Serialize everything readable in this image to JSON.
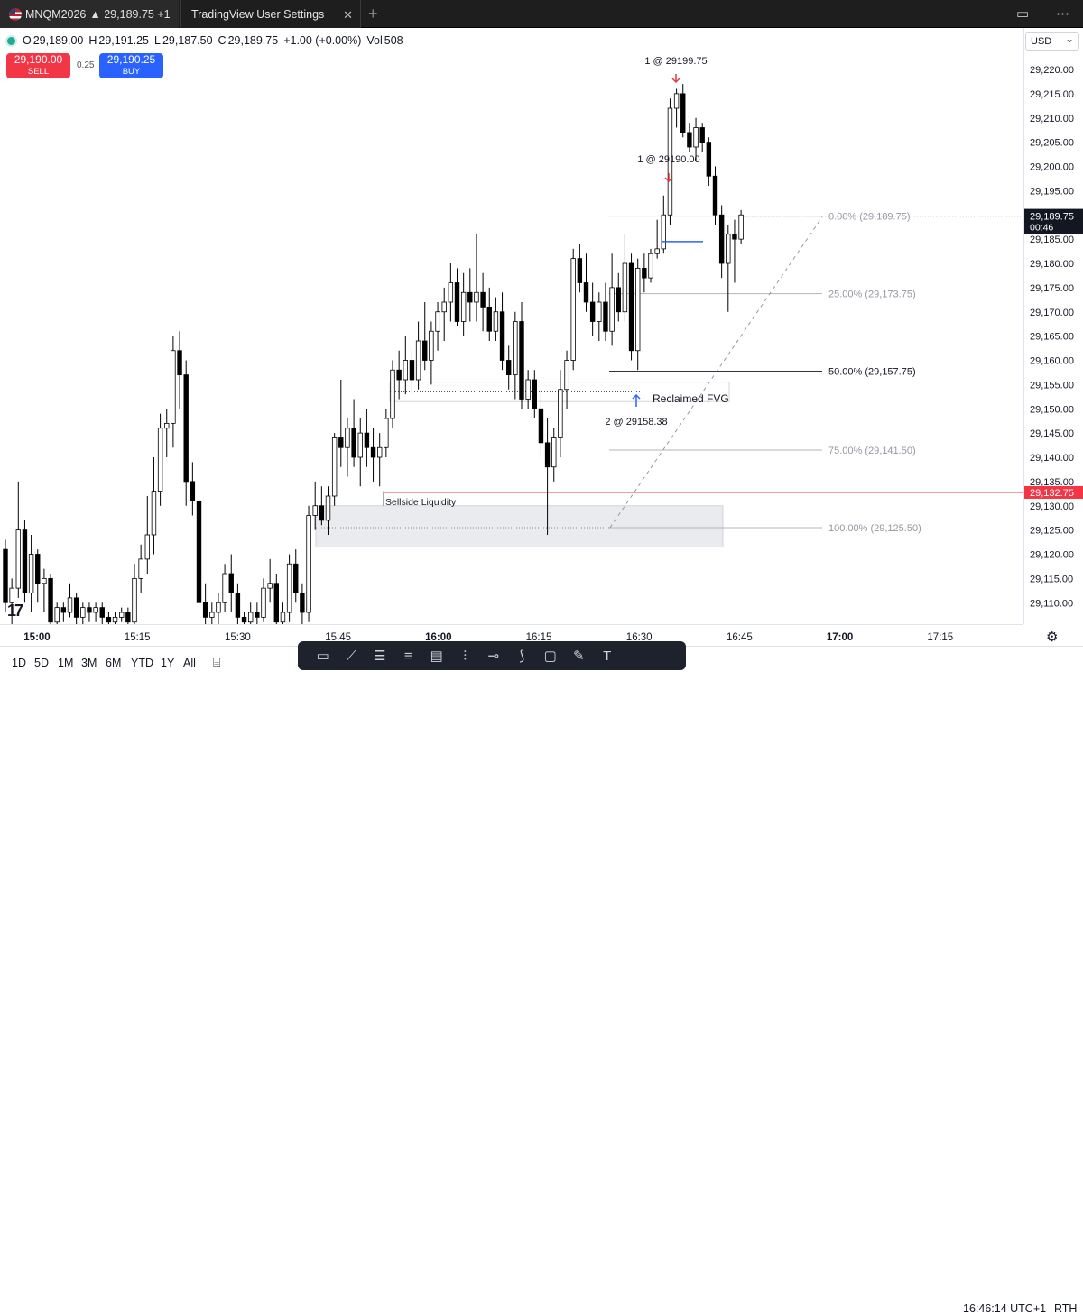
{
  "tabs": [
    {
      "symbol": "MNQM2026",
      "price": "▲ 29,189.75 +1"
    },
    {
      "label": "TradingView User Settings"
    }
  ],
  "legend": {
    "o_key": "O",
    "o_val": "29,189.00",
    "h_key": "H",
    "h_val": "29,191.25",
    "l_key": "L",
    "l_val": "29,187.50",
    "c_key": "C",
    "c_val": "29,189.75",
    "change": "+1.00 (+0.00%)",
    "vol_key": "Vol",
    "vol_val": "508"
  },
  "trade": {
    "sell_price": "29,190.00",
    "sell_label": "SELL",
    "spread": "0.25",
    "buy_price": "29,190.25",
    "buy_label": "BUY"
  },
  "price_axis": {
    "currency": "USD",
    "ticks": [
      "29,220.00",
      "29,215.00",
      "29,210.00",
      "29,205.00",
      "29,200.00",
      "29,195.00",
      "29,190.00",
      "29,185.00",
      "29,180.00",
      "29,175.00",
      "29,170.00",
      "29,165.00",
      "29,160.00",
      "29,155.00",
      "29,150.00",
      "29,145.00",
      "29,140.00",
      "29,135.00",
      "29,130.00",
      "29,125.00",
      "29,120.00",
      "29,115.00",
      "29,110.00"
    ],
    "current_price": "29,189.75",
    "countdown": "00:46",
    "red_line_price": "29,132.75"
  },
  "time_axis": {
    "ticks": [
      {
        "label": "15:00",
        "bold": true
      },
      {
        "label": "15:15",
        "bold": false
      },
      {
        "label": "15:30",
        "bold": false
      },
      {
        "label": "15:45",
        "bold": false
      },
      {
        "label": "16:00",
        "bold": true
      },
      {
        "label": "16:15",
        "bold": false
      },
      {
        "label": "16:30",
        "bold": false
      },
      {
        "label": "16:45",
        "bold": false
      },
      {
        "label": "17:00",
        "bold": true
      },
      {
        "label": "17:15",
        "bold": false
      }
    ]
  },
  "fib_levels": [
    {
      "label": "0.00% (29,189.75)",
      "price": 29189.75,
      "emphasis": false
    },
    {
      "label": "25.00% (29,173.75)",
      "price": 29173.75,
      "emphasis": false
    },
    {
      "label": "50.00% (29,157.75)",
      "price": 29157.75,
      "emphasis": true
    },
    {
      "label": "75.00% (29,141.50)",
      "price": 29141.5,
      "emphasis": false
    },
    {
      "label": "100.00% (29,125.50)",
      "price": 29125.5,
      "emphasis": false
    }
  ],
  "annotations": {
    "sellside_liquidity": "Sellside Liquidity",
    "reclaimed_fvg": "Reclaimed FVG",
    "exec_top": "1 @ 29199.75",
    "exec_mid": "1 @ 29190.00",
    "exec_buy": "2 @ 29158.38"
  },
  "ranges": [
    "1D",
    "5D",
    "1M",
    "3M",
    "6M",
    "YTD",
    "1Y",
    "All"
  ],
  "drawing_tools": [
    "rectangle-icon",
    "trendline-icon",
    "fib-icon",
    "pitchfork-icon",
    "gann-icon",
    "long-position-icon",
    "ray-icon",
    "path-icon",
    "callout-icon",
    "brush-icon",
    "text-icon"
  ],
  "status": {
    "clock": "16:46:14 UTC+1",
    "session": "RTH"
  },
  "colors": {
    "up": "#ffffff",
    "down": "#000000",
    "sell": "#f23645",
    "buy": "#2962ff",
    "exec_sell": "#e53935",
    "exec_buy": "#2962ff"
  },
  "chart_data": {
    "type": "candlestick",
    "title": "",
    "ylim": [
      29105,
      29225
    ],
    "candles": [
      [
        29121,
        29123,
        29108,
        29110
      ],
      [
        29110,
        29115,
        29105,
        29113
      ],
      [
        29113,
        29135,
        29111,
        29125
      ],
      [
        29125,
        29127,
        29110,
        29112
      ],
      [
        29112,
        29124,
        29108,
        29120
      ],
      [
        29120,
        29121,
        29110,
        29114
      ],
      [
        29114,
        29117,
        29108,
        29115
      ],
      [
        29115,
        29116,
        29105,
        29106
      ],
      [
        29106,
        29110,
        29105,
        29109
      ],
      [
        29109,
        29110,
        29106,
        29108
      ],
      [
        29108,
        29114,
        29107,
        29111
      ],
      [
        29111,
        29112,
        29105,
        29107
      ],
      [
        29107,
        29110,
        29105,
        29109
      ],
      [
        29109,
        29110,
        29106,
        29108
      ],
      [
        29108,
        29110,
        29106,
        29109
      ],
      [
        29109,
        29110,
        29105,
        29107
      ],
      [
        29107,
        29108,
        29105,
        29106
      ],
      [
        29106,
        29108,
        29105,
        29107
      ],
      [
        29107,
        29109,
        29106,
        29108
      ],
      [
        29108,
        29109,
        29105,
        29106
      ],
      [
        29106,
        29118,
        29105,
        29115
      ],
      [
        29115,
        29122,
        29112,
        29119
      ],
      [
        29119,
        29132,
        29116,
        29124
      ],
      [
        29124,
        29140,
        29120,
        29133
      ],
      [
        29133,
        29149,
        29130,
        29146
      ],
      [
        29146,
        29150,
        29140,
        29147
      ],
      [
        29147,
        29165,
        29142,
        29162
      ],
      [
        29162,
        29166,
        29150,
        29157
      ],
      [
        29157,
        29160,
        29130,
        29135
      ],
      [
        29135,
        29139,
        29128,
        29131
      ],
      [
        29131,
        29135,
        29105,
        29110
      ],
      [
        29110,
        29114,
        29105,
        29107
      ],
      [
        29107,
        29110,
        29105,
        29108
      ],
      [
        29108,
        29112,
        29105,
        29110
      ],
      [
        29110,
        29118,
        29108,
        29116
      ],
      [
        29116,
        29120,
        29108,
        29112
      ],
      [
        29112,
        29114,
        29105,
        29107
      ],
      [
        29107,
        29108,
        29105,
        29106
      ],
      [
        29106,
        29110,
        29105,
        29108
      ],
      [
        29108,
        29110,
        29105,
        29107
      ],
      [
        29107,
        29115,
        29106,
        29113
      ],
      [
        29113,
        29119,
        29110,
        29114
      ],
      [
        29114,
        29116,
        29105,
        29106
      ],
      [
        29106,
        29110,
        29105,
        29108
      ],
      [
        29108,
        29120,
        29106,
        29118
      ],
      [
        29118,
        29121,
        29110,
        29112
      ],
      [
        29112,
        29114,
        29105,
        29108
      ],
      [
        29108,
        29130,
        29106,
        29128
      ],
      [
        29128,
        29135,
        29125,
        29130
      ],
      [
        29130,
        29134,
        29126,
        29127
      ],
      [
        29127,
        29134,
        29124,
        29132
      ],
      [
        29132,
        29145,
        29130,
        29144
      ],
      [
        29144,
        29156,
        29138,
        29142
      ],
      [
        29142,
        29148,
        29136,
        29146
      ],
      [
        29146,
        29152,
        29138,
        29140
      ],
      [
        29140,
        29148,
        29134,
        29145
      ],
      [
        29145,
        29150,
        29138,
        29142
      ],
      [
        29142,
        29146,
        29135,
        29140
      ],
      [
        29140,
        29145,
        29134,
        29142
      ],
      [
        29142,
        29150,
        29140,
        29148
      ],
      [
        29148,
        29160,
        29146,
        29158
      ],
      [
        29158,
        29162,
        29152,
        29156
      ],
      [
        29156,
        29165,
        29153,
        29160
      ],
      [
        29160,
        29162,
        29153,
        29156
      ],
      [
        29156,
        29168,
        29154,
        29164
      ],
      [
        29164,
        29172,
        29158,
        29160
      ],
      [
        29160,
        29168,
        29155,
        29166
      ],
      [
        29166,
        29172,
        29162,
        29170
      ],
      [
        29170,
        29175,
        29164,
        29172
      ],
      [
        29172,
        29180,
        29168,
        29176
      ],
      [
        29176,
        29179,
        29167,
        29168
      ],
      [
        29168,
        29178,
        29165,
        29174
      ],
      [
        29174,
        29179,
        29168,
        29172
      ],
      [
        29172,
        29186,
        29168,
        29174
      ],
      [
        29174,
        29178,
        29166,
        29171
      ],
      [
        29171,
        29175,
        29164,
        29166
      ],
      [
        29166,
        29173,
        29164,
        29170
      ],
      [
        29170,
        29174,
        29158,
        29160
      ],
      [
        29160,
        29163,
        29154,
        29157
      ],
      [
        29157,
        29170,
        29152,
        29168
      ],
      [
        29168,
        29172,
        29150,
        29152
      ],
      [
        29152,
        29158,
        29150,
        29156
      ],
      [
        29156,
        29158,
        29148,
        29150
      ],
      [
        29150,
        29154,
        29140,
        29143
      ],
      [
        29143,
        29148,
        29124,
        29138
      ],
      [
        29138,
        29146,
        29135,
        29144
      ],
      [
        29144,
        29158,
        29140,
        29154
      ],
      [
        29154,
        29162,
        29150,
        29160
      ],
      [
        29160,
        29183,
        29158,
        29181
      ],
      [
        29181,
        29184,
        29174,
        29176
      ],
      [
        29176,
        29182,
        29170,
        29172
      ],
      [
        29172,
        29176,
        29165,
        29168
      ],
      [
        29168,
        29174,
        29164,
        29172
      ],
      [
        29172,
        29176,
        29164,
        29166
      ],
      [
        29166,
        29182,
        29163,
        29175
      ],
      [
        29175,
        29178,
        29168,
        29170
      ],
      [
        29170,
        29186,
        29168,
        29180
      ],
      [
        29180,
        29182,
        29160,
        29162
      ],
      [
        29162,
        29181,
        29158,
        29179
      ],
      [
        29179,
        29182,
        29174,
        29177
      ],
      [
        29177,
        29183,
        29176,
        29182
      ],
      [
        29182,
        29189,
        29181,
        29183
      ],
      [
        29183,
        29194,
        29182,
        29190
      ],
      [
        29190,
        29214,
        29188,
        29212
      ],
      [
        29212,
        29216,
        29208,
        29215
      ],
      [
        29215,
        29217,
        29206,
        29207
      ],
      [
        29207,
        29209,
        29203,
        29204
      ],
      [
        29204,
        29210,
        29201,
        29208
      ],
      [
        29208,
        29209,
        29203,
        29205
      ],
      [
        29205,
        29206,
        29196,
        29198
      ],
      [
        29198,
        29200,
        29188,
        29190
      ],
      [
        29190,
        29192,
        29177,
        29180
      ],
      [
        29180,
        29188,
        29170,
        29186
      ],
      [
        29186,
        29189,
        29176,
        29185
      ],
      [
        29185,
        29191,
        29184,
        29190
      ]
    ]
  }
}
